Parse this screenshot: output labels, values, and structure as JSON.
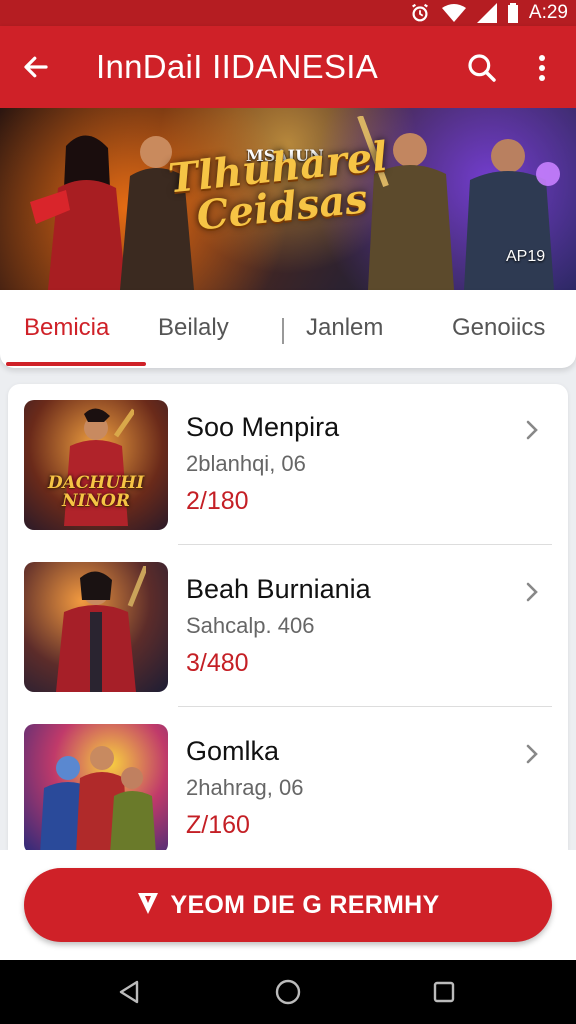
{
  "status_bar": {
    "time": "A:29",
    "icons": [
      "alarm-icon",
      "wifi-icon",
      "signal-icon",
      "battery-icon"
    ]
  },
  "app_bar": {
    "title": "InnDaiI IIDANESIA",
    "icons": [
      "arrow-back-icon",
      "search-icon",
      "more-vert-icon"
    ]
  },
  "banner": {
    "title": "Tlhuharel Ceidsas",
    "kicker": "MSAIUN",
    "badge": "AP19"
  },
  "tabs": [
    {
      "label": "Bemicia",
      "active": true
    },
    {
      "label": "Beilaly",
      "active": false
    },
    {
      "label": "Janlem",
      "active": false
    },
    {
      "label": "Genoiics",
      "active": false
    }
  ],
  "games": [
    {
      "title": "Soo Menpira",
      "subtitle": "2blanhqi, 06",
      "price": "2/180",
      "thumb_text": "DACHUHI NINOR"
    },
    {
      "title": "Beah Burniania",
      "subtitle": "Sahcalp. 406",
      "price": "3/480",
      "thumb_text": ""
    },
    {
      "title": "Gomlka",
      "subtitle": "2hahrag, 06",
      "price": "Z/160",
      "thumb_text": ""
    }
  ],
  "cta": {
    "label": "YEOM DIE G RERMHY",
    "icon": "shield-icon"
  },
  "nav_bar": {
    "icons": [
      "back-triangle-icon",
      "home-circle-icon",
      "recents-square-icon"
    ]
  },
  "colors": {
    "primary": "#cf2128",
    "status_bar": "#b51d22",
    "price": "#c41f25"
  }
}
